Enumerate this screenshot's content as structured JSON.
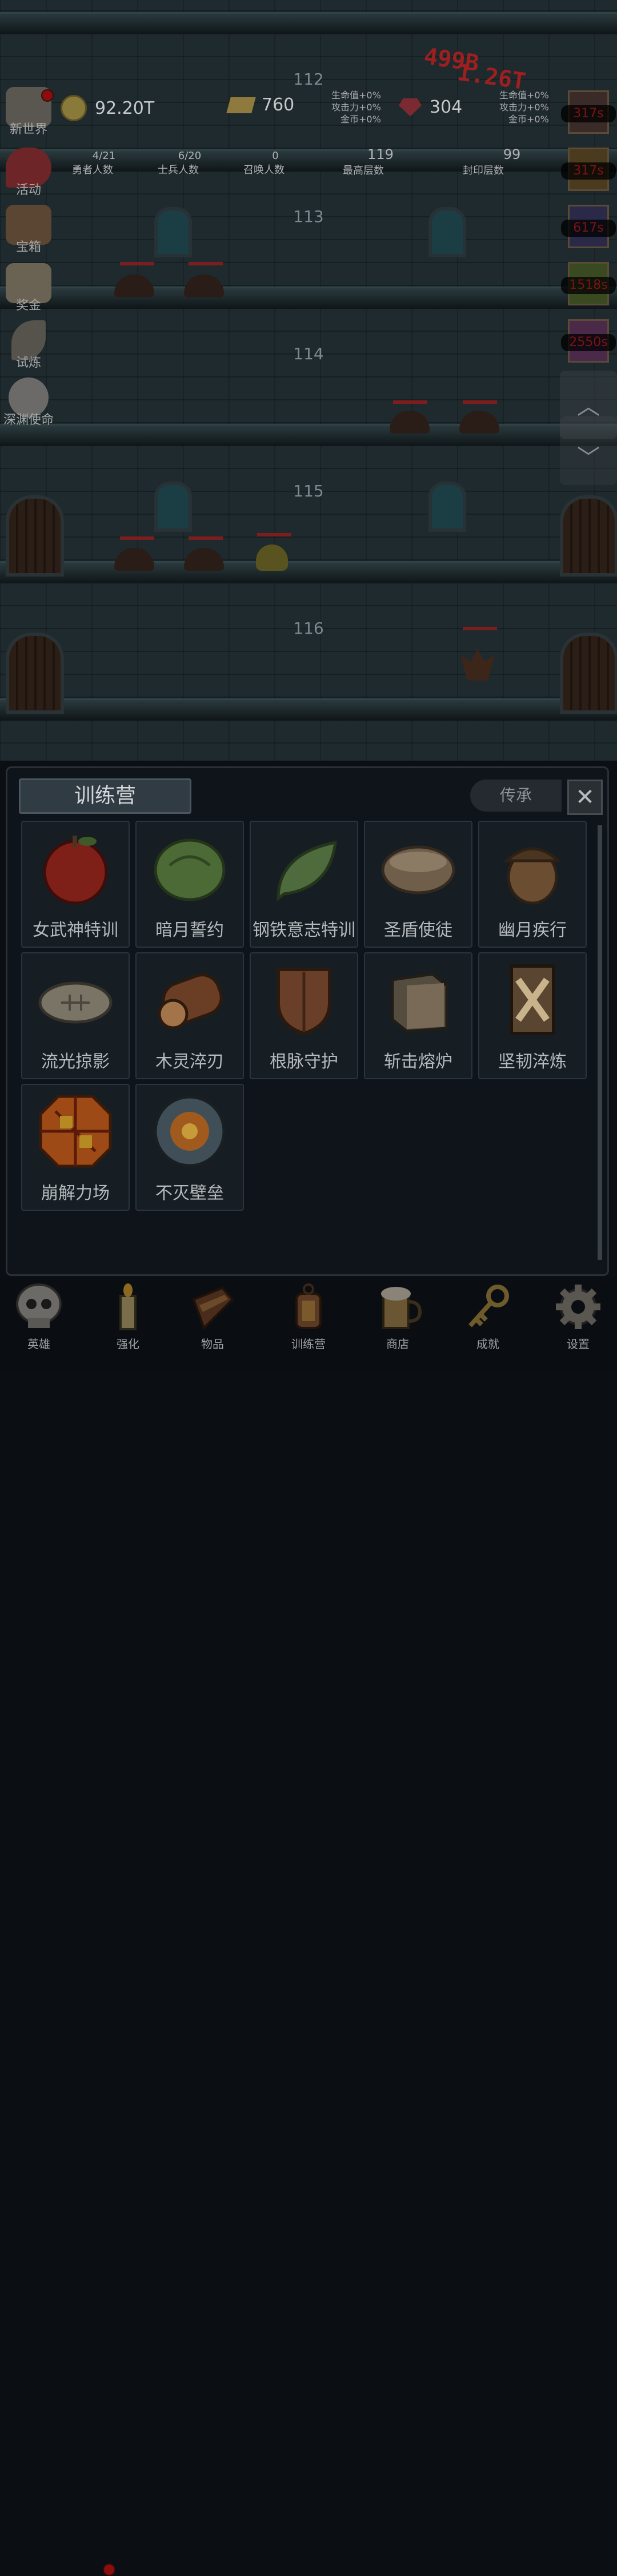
{
  "floors": [
    "112",
    "113",
    "114",
    "115",
    "116"
  ],
  "damage": {
    "a": "499B",
    "b": "1.26T"
  },
  "resources": {
    "gold": "92.20T",
    "bars": "760",
    "gems": "304",
    "bonus_left": [
      "生命值+0%",
      "攻击力+0%",
      "金币+0%"
    ],
    "bonus_right": [
      "生命值+0%",
      "攻击力+0%",
      "金币+0%"
    ]
  },
  "stats": [
    {
      "value": "4/21",
      "label": "勇者人数"
    },
    {
      "value": "6/20",
      "label": "士兵人数"
    },
    {
      "value": "0",
      "label": "召唤人数"
    },
    {
      "value": "119",
      "label": "最高层数"
    },
    {
      "value": "99",
      "label": "封印层数"
    }
  ],
  "sidebar": [
    {
      "label": "新世界",
      "icon": "castle-icon"
    },
    {
      "label": "活动",
      "icon": "heart-icon"
    },
    {
      "label": "宝箱",
      "icon": "chest-icon"
    },
    {
      "label": "奖金",
      "icon": "envelope-icon"
    },
    {
      "label": "试炼",
      "icon": "feather-icon"
    },
    {
      "label": "深渊使命",
      "icon": "orb-icon"
    }
  ],
  "timers": [
    "317s",
    "317s",
    "617s",
    "1518s",
    "2550s"
  ],
  "panel": {
    "title": "训练营",
    "inherit": "传承",
    "items": [
      {
        "name": "女武神特训",
        "icon": "apple-icon",
        "color": "#7e1f18"
      },
      {
        "name": "暗月誓约",
        "icon": "cabbage-icon",
        "color": "#4c6a36"
      },
      {
        "name": "钢铁意志特训",
        "icon": "leaf-icon",
        "color": "#4d6b3c"
      },
      {
        "name": "圣盾使徒",
        "icon": "bowl-icon",
        "color": "#6e5e4a"
      },
      {
        "name": "幽月疾行",
        "icon": "acorn-icon",
        "color": "#6b4e32"
      },
      {
        "name": "流光掠影",
        "icon": "fish-icon",
        "color": "#7a7466"
      },
      {
        "name": "木灵淬刃",
        "icon": "log-icon",
        "color": "#6a3e25"
      },
      {
        "name": "根脉守护",
        "icon": "wood-shield-icon",
        "color": "#6a3f2a"
      },
      {
        "name": "斩击熔炉",
        "icon": "iron-block-icon",
        "color": "#554c40"
      },
      {
        "name": "坚韧淬炼",
        "icon": "plank-shield-icon",
        "color": "#5a4630"
      },
      {
        "name": "崩解力场",
        "icon": "lava-tile-icon",
        "color": "#9e4a16"
      },
      {
        "name": "不灭壁垒",
        "icon": "rune-disc-icon",
        "color": "#3f4e57"
      }
    ]
  },
  "nav": [
    {
      "label": "英雄",
      "icon": "skull-icon"
    },
    {
      "label": "强化",
      "icon": "candle-icon"
    },
    {
      "label": "物品",
      "icon": "book-icon"
    },
    {
      "label": "训练营",
      "icon": "lantern-icon"
    },
    {
      "label": "商店",
      "icon": "beer-mug-icon"
    },
    {
      "label": "成就",
      "icon": "key-icon"
    },
    {
      "label": "设置",
      "icon": "gear-icon"
    }
  ]
}
